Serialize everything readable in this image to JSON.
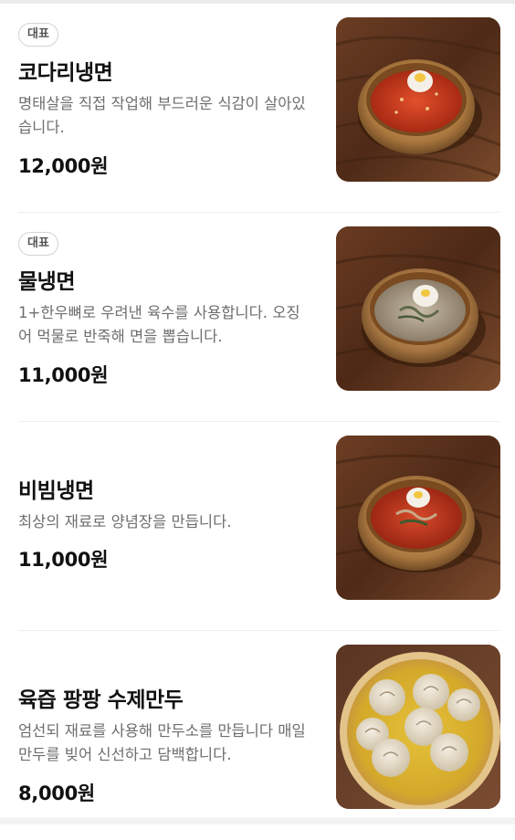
{
  "menu": {
    "items": [
      {
        "badge": "대표",
        "name": "코다리냉면",
        "description": "명태살을 직접 작업해 부드러운 식감이 살아있습니다.",
        "price": "12,000원",
        "image": "bibim-naengmyeon-with-pollock-photo"
      },
      {
        "badge": "대표",
        "name": "물냉면",
        "description": "1+한우뼈로 우려낸 육수를 사용합니다. 오징어 먹물로 반죽해 면을 뽑습니다.",
        "price": "11,000원",
        "image": "mul-naengmyeon-photo"
      },
      {
        "name": "비빔냉면",
        "description": "최상의 재료로 양념장을 만듭니다.",
        "price": "11,000원",
        "image": "bibim-naengmyeon-photo"
      },
      {
        "name": "육즙 팡팡 수제만두",
        "description": "엄선되 재료를 사용해 만두소를 만듭니다 매일 만두를 빚어 신선하고 담백합니다.",
        "price": "8,000원",
        "image": "steamed-dumplings-photo"
      }
    ]
  }
}
